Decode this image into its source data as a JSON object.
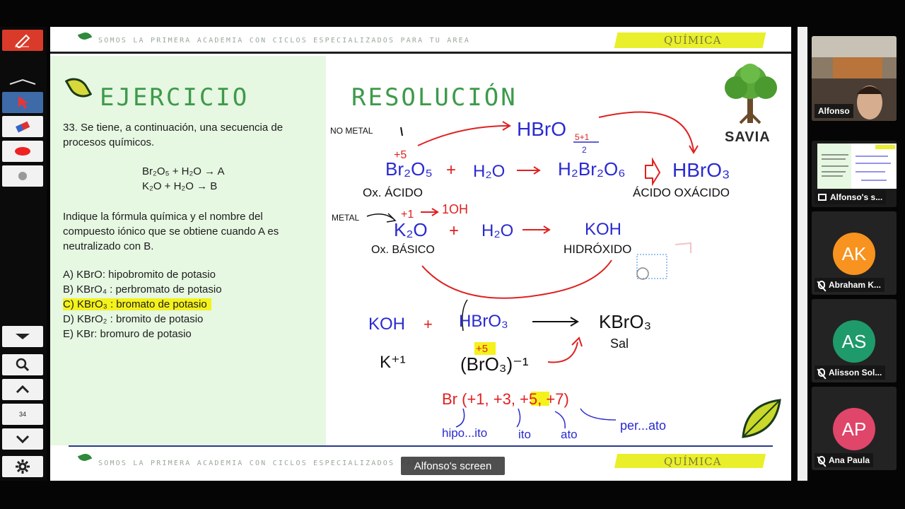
{
  "slide": {
    "banner_text": "SOMOS LA PRIMERA ACADEMIA CON CICLOS ESPECIALIZADOS PARA TU AREA",
    "subject": "QUÍMICA",
    "heading_left": "EJERCICIO",
    "heading_right": "RESOLUCIÓN",
    "logo": "SAVIA",
    "problem": {
      "intro": "33. Se tiene, a continuación, una secuencia de procesos químicos.",
      "eq1": "Br₂O₅ + H₂O → A",
      "eq2": "K₂O + H₂O → B",
      "question": "Indique la fórmula química y el nombre del compuesto iónico que se obtiene cuando A es neutralizado con B.",
      "options": [
        "A) KBrO: hipobromito de potasio",
        "B) KBrO₄ : perbromato de potasio",
        "C) KBrO₃ : bromato de potasio",
        "D) KBrO₂ : bromito de potasio",
        "E) KBr: bromuro de potasio"
      ],
      "highlighted_option": 2
    },
    "handwriting": {
      "no_metal": "NO METAL",
      "hbro_top": "HBrO",
      "frac": "5+1",
      "frac_den": "2",
      "plus5": "+5",
      "br2o5": "Br₂O₅",
      "plus": "+",
      "h2o": "H₂O",
      "h2br2o6": "H₂Br₂O₆",
      "hbro3": "HBrO₃",
      "ox_acido": "Ox. ÁCIDO",
      "acido_oxacido": "ÁCIDO OXÁCIDO",
      "metal": "METAL",
      "plus1": "+1",
      "oh": "1OH",
      "k2o": "K₂O",
      "koh": "KOH",
      "ox_basico": "Ox. BÁSICO",
      "hidroxido": "HIDRÓXIDO",
      "koh2": "KOH",
      "hbro3_2": "HBrO₃",
      "kbro3": "KBrO₃",
      "sal": "Sal",
      "k_plus1": "K⁺¹",
      "bro3": "(BrO₃)⁻¹",
      "plus5b": "+5",
      "br_states": "Br (+1, +3, +5, +7)",
      "suffixes": [
        "hipo...ito",
        "ito",
        "ato",
        "per...ato"
      ]
    }
  },
  "toolbar": {
    "page_number": "34"
  },
  "screen_label": "Alfonso's screen",
  "participants": [
    {
      "name": "Alfonso",
      "type": "video"
    },
    {
      "name": "Alfonso's s...",
      "type": "screen"
    },
    {
      "name": "Abraham K...",
      "initials": "AK",
      "color": "#f7931e",
      "muted": true
    },
    {
      "name": "Alisson Sol...",
      "initials": "AS",
      "color": "#1f9a6a",
      "muted": true
    },
    {
      "name": "Ana Paula",
      "initials": "AP",
      "color": "#e0456a",
      "muted": true
    }
  ]
}
